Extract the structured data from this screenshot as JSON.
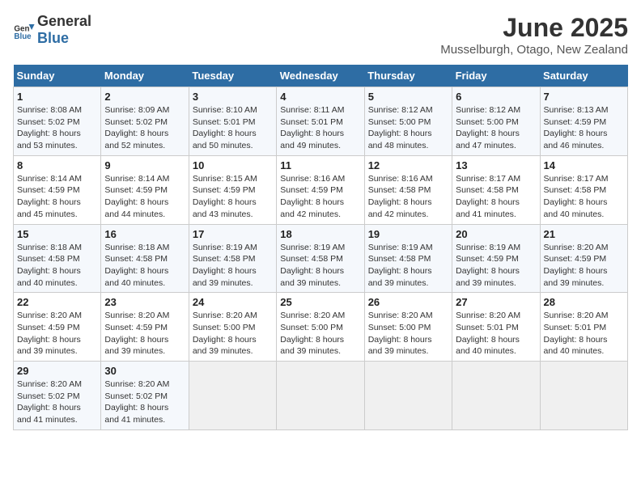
{
  "header": {
    "logo_general": "General",
    "logo_blue": "Blue",
    "month": "June 2025",
    "location": "Musselburgh, Otago, New Zealand"
  },
  "weekdays": [
    "Sunday",
    "Monday",
    "Tuesday",
    "Wednesday",
    "Thursday",
    "Friday",
    "Saturday"
  ],
  "weeks": [
    [
      {
        "day": "1",
        "sunrise": "8:08 AM",
        "sunset": "5:02 PM",
        "daylight": "8 hours and 53 minutes."
      },
      {
        "day": "2",
        "sunrise": "8:09 AM",
        "sunset": "5:02 PM",
        "daylight": "8 hours and 52 minutes."
      },
      {
        "day": "3",
        "sunrise": "8:10 AM",
        "sunset": "5:01 PM",
        "daylight": "8 hours and 50 minutes."
      },
      {
        "day": "4",
        "sunrise": "8:11 AM",
        "sunset": "5:01 PM",
        "daylight": "8 hours and 49 minutes."
      },
      {
        "day": "5",
        "sunrise": "8:12 AM",
        "sunset": "5:00 PM",
        "daylight": "8 hours and 48 minutes."
      },
      {
        "day": "6",
        "sunrise": "8:12 AM",
        "sunset": "5:00 PM",
        "daylight": "8 hours and 47 minutes."
      },
      {
        "day": "7",
        "sunrise": "8:13 AM",
        "sunset": "4:59 PM",
        "daylight": "8 hours and 46 minutes."
      }
    ],
    [
      {
        "day": "8",
        "sunrise": "8:14 AM",
        "sunset": "4:59 PM",
        "daylight": "8 hours and 45 minutes."
      },
      {
        "day": "9",
        "sunrise": "8:14 AM",
        "sunset": "4:59 PM",
        "daylight": "8 hours and 44 minutes."
      },
      {
        "day": "10",
        "sunrise": "8:15 AM",
        "sunset": "4:59 PM",
        "daylight": "8 hours and 43 minutes."
      },
      {
        "day": "11",
        "sunrise": "8:16 AM",
        "sunset": "4:59 PM",
        "daylight": "8 hours and 42 minutes."
      },
      {
        "day": "12",
        "sunrise": "8:16 AM",
        "sunset": "4:58 PM",
        "daylight": "8 hours and 42 minutes."
      },
      {
        "day": "13",
        "sunrise": "8:17 AM",
        "sunset": "4:58 PM",
        "daylight": "8 hours and 41 minutes."
      },
      {
        "day": "14",
        "sunrise": "8:17 AM",
        "sunset": "4:58 PM",
        "daylight": "8 hours and 40 minutes."
      }
    ],
    [
      {
        "day": "15",
        "sunrise": "8:18 AM",
        "sunset": "4:58 PM",
        "daylight": "8 hours and 40 minutes."
      },
      {
        "day": "16",
        "sunrise": "8:18 AM",
        "sunset": "4:58 PM",
        "daylight": "8 hours and 40 minutes."
      },
      {
        "day": "17",
        "sunrise": "8:19 AM",
        "sunset": "4:58 PM",
        "daylight": "8 hours and 39 minutes."
      },
      {
        "day": "18",
        "sunrise": "8:19 AM",
        "sunset": "4:58 PM",
        "daylight": "8 hours and 39 minutes."
      },
      {
        "day": "19",
        "sunrise": "8:19 AM",
        "sunset": "4:58 PM",
        "daylight": "8 hours and 39 minutes."
      },
      {
        "day": "20",
        "sunrise": "8:19 AM",
        "sunset": "4:59 PM",
        "daylight": "8 hours and 39 minutes."
      },
      {
        "day": "21",
        "sunrise": "8:20 AM",
        "sunset": "4:59 PM",
        "daylight": "8 hours and 39 minutes."
      }
    ],
    [
      {
        "day": "22",
        "sunrise": "8:20 AM",
        "sunset": "4:59 PM",
        "daylight": "8 hours and 39 minutes."
      },
      {
        "day": "23",
        "sunrise": "8:20 AM",
        "sunset": "4:59 PM",
        "daylight": "8 hours and 39 minutes."
      },
      {
        "day": "24",
        "sunrise": "8:20 AM",
        "sunset": "5:00 PM",
        "daylight": "8 hours and 39 minutes."
      },
      {
        "day": "25",
        "sunrise": "8:20 AM",
        "sunset": "5:00 PM",
        "daylight": "8 hours and 39 minutes."
      },
      {
        "day": "26",
        "sunrise": "8:20 AM",
        "sunset": "5:00 PM",
        "daylight": "8 hours and 39 minutes."
      },
      {
        "day": "27",
        "sunrise": "8:20 AM",
        "sunset": "5:01 PM",
        "daylight": "8 hours and 40 minutes."
      },
      {
        "day": "28",
        "sunrise": "8:20 AM",
        "sunset": "5:01 PM",
        "daylight": "8 hours and 40 minutes."
      }
    ],
    [
      {
        "day": "29",
        "sunrise": "8:20 AM",
        "sunset": "5:02 PM",
        "daylight": "8 hours and 41 minutes."
      },
      {
        "day": "30",
        "sunrise": "8:20 AM",
        "sunset": "5:02 PM",
        "daylight": "8 hours and 41 minutes."
      },
      null,
      null,
      null,
      null,
      null
    ]
  ],
  "labels": {
    "sunrise": "Sunrise:",
    "sunset": "Sunset:",
    "daylight": "Daylight:"
  }
}
